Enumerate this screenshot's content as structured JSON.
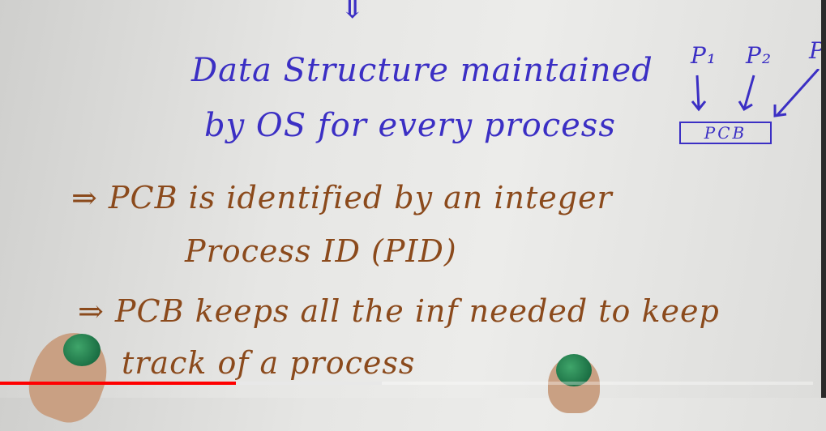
{
  "video": {
    "whiteboard": {
      "heading_line1": "Data Structure maintained",
      "heading_line2": "by OS for every process",
      "bullet1_line1": "⇒ PCB is identified by an integer",
      "bullet1_line2": "Process ID (PID)",
      "bullet2_line1": "⇒ PCB keeps all the inf needed to keep",
      "bullet2_line2": "track of a process",
      "diagram": {
        "p1": "P₁",
        "p2": "P₂",
        "p3": "P",
        "box_label": "PCB"
      },
      "arrow_top": "⇓"
    },
    "progress": {
      "played_percent": 29,
      "buffered_percent": 47
    },
    "colors": {
      "blue_marker": "#3b2fc4",
      "brown_marker": "#8b4a1c",
      "progress_red": "#ff0000"
    }
  }
}
